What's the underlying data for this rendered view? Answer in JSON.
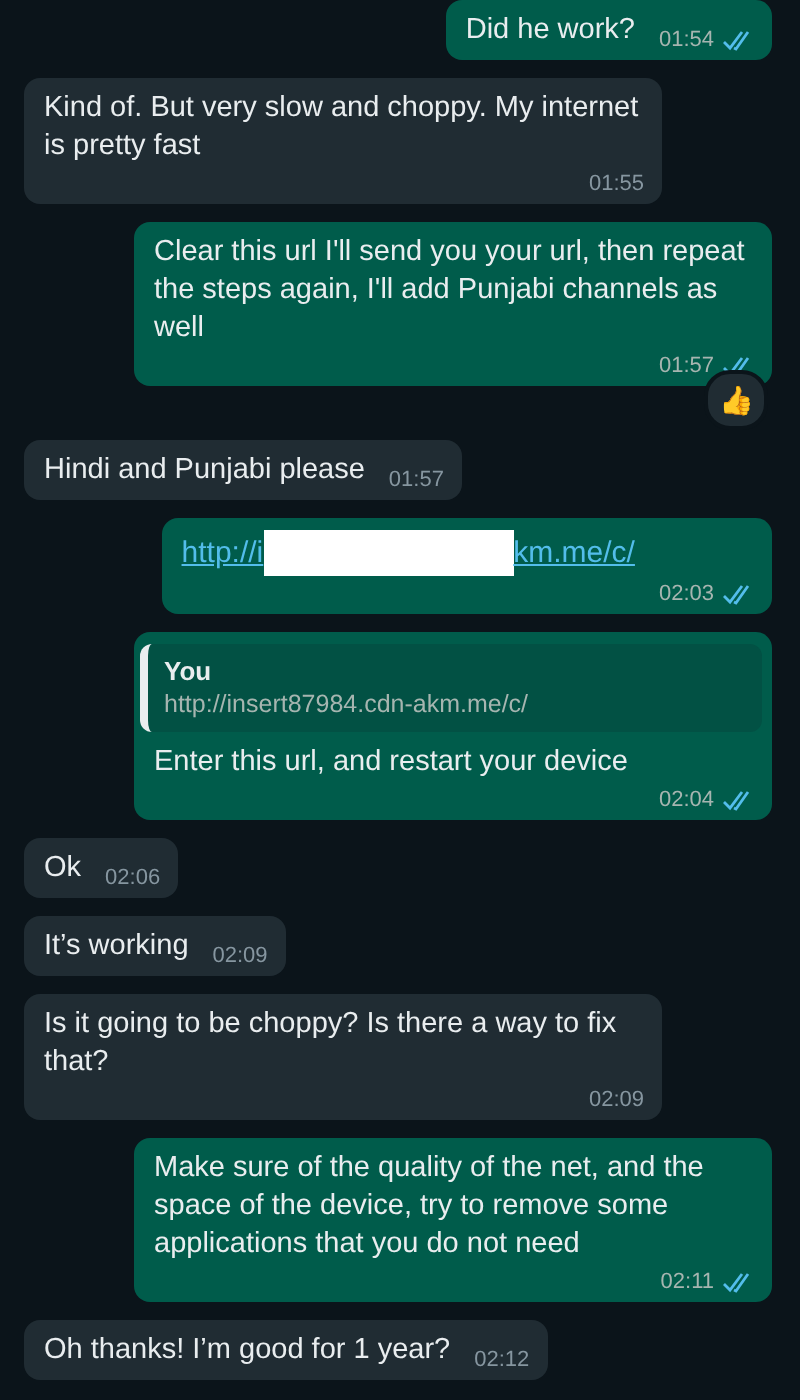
{
  "messages": [
    {
      "kind": "text",
      "outgoing": true,
      "text": "Did he work?",
      "time": "01:54",
      "read": true
    },
    {
      "kind": "text",
      "outgoing": false,
      "text": "Kind of. But very slow and choppy. My internet is pretty fast",
      "time": "01:55"
    },
    {
      "kind": "text",
      "outgoing": true,
      "text": "Clear this url I'll send you your url, then repeat the steps again, I'll add Punjabi channels as well",
      "time": "01:57",
      "read": true,
      "reaction": "👍"
    },
    {
      "kind": "text",
      "outgoing": false,
      "text": "Hindi and Punjabi please",
      "time": "01:57"
    },
    {
      "kind": "link",
      "outgoing": true,
      "link_start": "http://i",
      "link_end": "km.me/c/",
      "redacted": true,
      "time": "02:03",
      "read": true
    },
    {
      "kind": "reply",
      "outgoing": true,
      "quote_author": "You",
      "quote_text": "http://insert87984.cdn-akm.me/c/",
      "text": "Enter this url, and restart your device",
      "time": "02:04",
      "read": true
    },
    {
      "kind": "text",
      "outgoing": false,
      "text": "Ok",
      "time": "02:06"
    },
    {
      "kind": "text",
      "outgoing": false,
      "text": "It’s working",
      "time": "02:09"
    },
    {
      "kind": "text",
      "outgoing": false,
      "text": "Is it going to be choppy? Is there a way to fix that?",
      "time": "02:09"
    },
    {
      "kind": "text",
      "outgoing": true,
      "text": "Make sure of the quality of the net, and the space of the device, try to remove some applications that you do not need",
      "time": "02:11",
      "read": true
    },
    {
      "kind": "text",
      "outgoing": false,
      "text": "Oh thanks! I’m good for 1 year?",
      "time": "02:12"
    }
  ]
}
